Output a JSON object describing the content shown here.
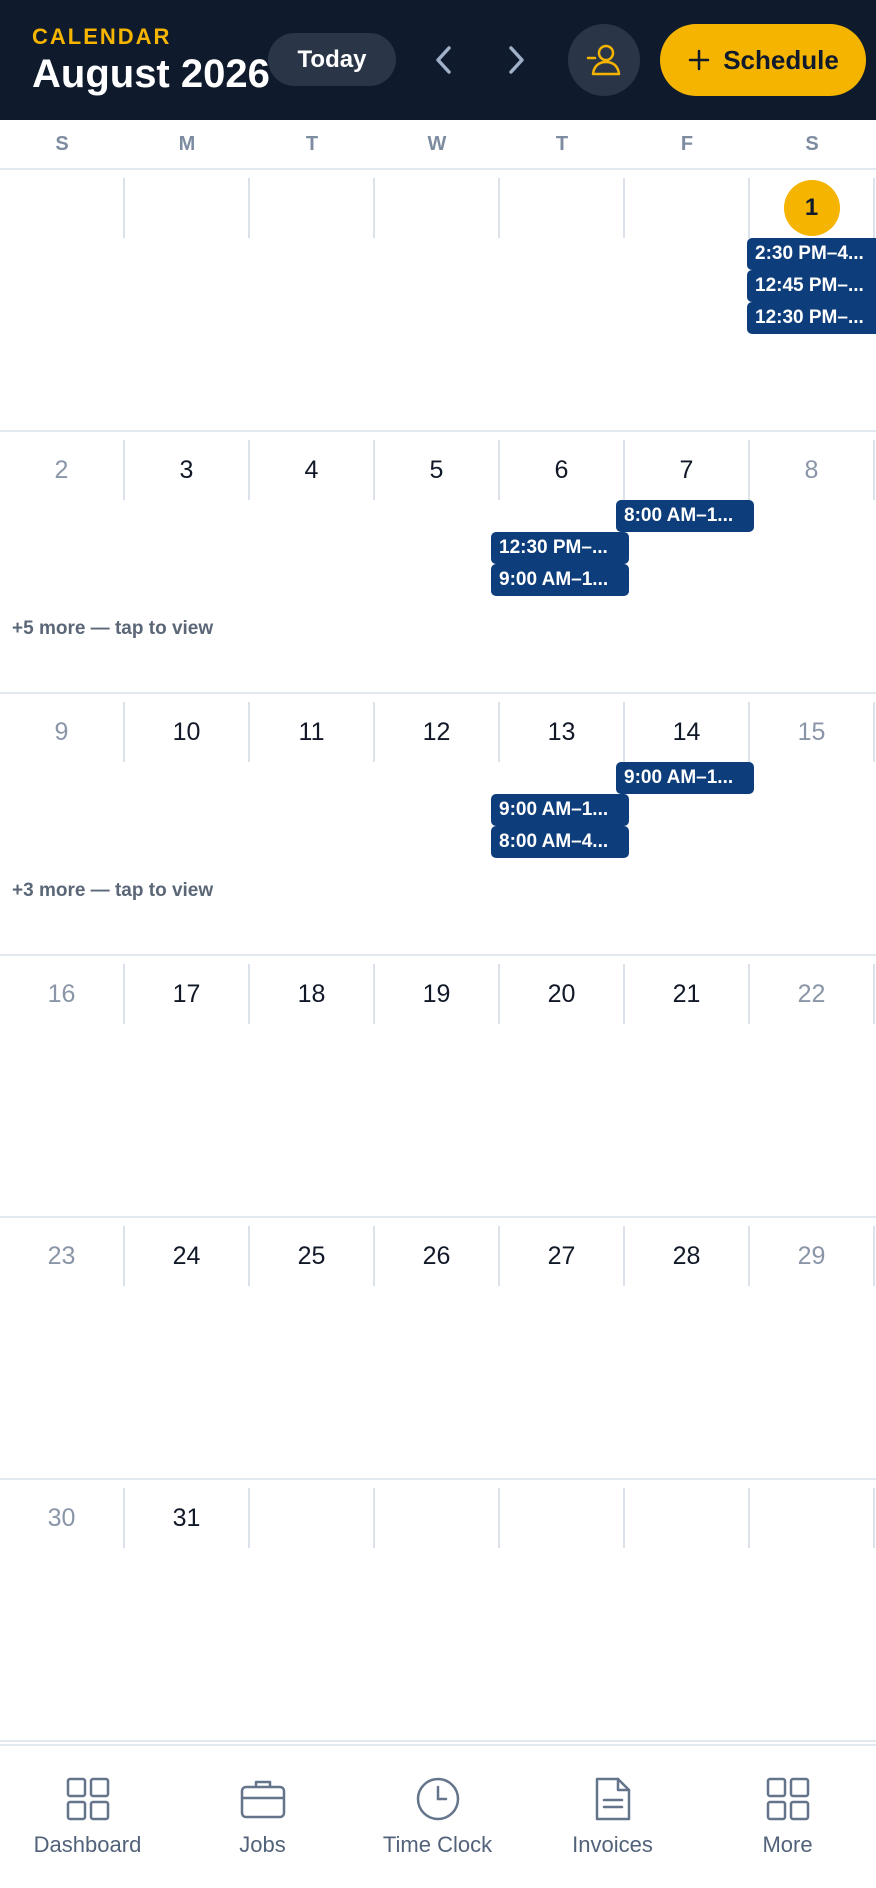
{
  "header": {
    "eyebrow": "CALENDAR",
    "title": "August 2026",
    "today_label": "Today",
    "schedule_label": "Schedule",
    "icons": {
      "prev": "chevron-left-icon",
      "next": "chevron-right-icon",
      "profile": "user-icon",
      "add": "plus-icon"
    }
  },
  "colors": {
    "header_bg": "#0f1b2d",
    "accent": "#f5b400",
    "event_bg": "#0d3d7a"
  },
  "weekdays": [
    "S",
    "M",
    "T",
    "W",
    "T",
    "F",
    "S"
  ],
  "weeks": [
    {
      "days": [
        "",
        "",
        "",
        "",
        "",
        "",
        "1"
      ],
      "events": [
        {
          "day": 6,
          "label": "2:30 PM–4..."
        },
        {
          "day": 6,
          "label": "12:45 PM–..."
        },
        {
          "day": 6,
          "label": "12:30 PM–..."
        }
      ],
      "more": ""
    },
    {
      "days": [
        "2",
        "3",
        "4",
        "5",
        "6",
        "7",
        "8"
      ],
      "events": [
        {
          "day": 5,
          "label": "8:00 AM–1..."
        },
        {
          "day": 4,
          "label": "12:30 PM–..."
        },
        {
          "day": 4,
          "label": "9:00 AM–1..."
        }
      ],
      "more": "+5 more — tap to view"
    },
    {
      "days": [
        "9",
        "10",
        "11",
        "12",
        "13",
        "14",
        "15"
      ],
      "events": [
        {
          "day": 5,
          "label": "9:00 AM–1..."
        },
        {
          "day": 4,
          "label": "9:00 AM–1..."
        },
        {
          "day": 4,
          "label": "8:00 AM–4..."
        }
      ],
      "more": "+3 more — tap to view"
    },
    {
      "days": [
        "16",
        "17",
        "18",
        "19",
        "20",
        "21",
        "22"
      ],
      "events": [],
      "more": ""
    },
    {
      "days": [
        "23",
        "24",
        "25",
        "26",
        "27",
        "28",
        "29"
      ],
      "events": [],
      "more": ""
    },
    {
      "days": [
        "30",
        "31",
        "",
        "",
        "",
        "",
        ""
      ],
      "events": [],
      "more": ""
    }
  ],
  "today": "1",
  "bottom_nav": [
    {
      "label": "Dashboard",
      "icon": "grid-icon"
    },
    {
      "label": "Jobs",
      "icon": "briefcase-icon"
    },
    {
      "label": "Time Clock",
      "icon": "clock-icon"
    },
    {
      "label": "Invoices",
      "icon": "document-icon"
    },
    {
      "label": "More",
      "icon": "grid-icon"
    }
  ]
}
